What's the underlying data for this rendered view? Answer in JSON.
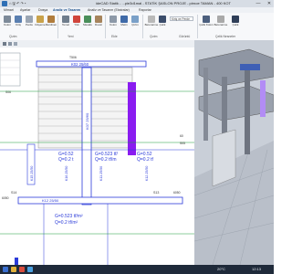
{
  "window": {
    "title": "ideCAD Statik - ...pie3d1mal - STATİK ŞASLON PROJE - pirnoe TAMAN - 400 KOT",
    "quick_access": "⌂ 🖫 ↶ ↷ ▾",
    "minimize": "—",
    "close": "✕"
  },
  "ribbon": {
    "tabs": [
      "Mimari",
      "Ayarlar",
      "Dosya",
      "Analiz ve Tasarım",
      "Analiz ve Tasarım (Ekstralar)",
      "Raporlar"
    ],
    "active_tab": "Analiz ve Tasarım",
    "buttons": [
      "Kolon",
      "Kiriş",
      "Perde",
      "Döşeme",
      "Merdiven",
      "Temel",
      "Yük",
      "Mesafe",
      "Duvar",
      "Kolon",
      "Metin",
      "Çizim",
      "Betonarme",
      "Çelik",
      "Çelik Kolon",
      "Betonarme",
      "Çelik"
    ],
    "groups": [
      "Çizim",
      "Yeni",
      "Ekle",
      "Çizim",
      "Görüntü",
      "Çelik Nesneler"
    ],
    "combo": "Kiriş ve Perde"
  },
  "drawing": {
    "grid_top": "T506",
    "beam_top": "K02 25/60",
    "beam_vertical": "K07 25/60",
    "beam_left_1": "K15 25/50",
    "beam_left_2": "K16 25/50",
    "beam_mid": "K11 25/50",
    "beam_right": "K12 25/50",
    "beam_bottom": "K12 25/50",
    "slab_1": "S14",
    "slab_2": "S13",
    "dim_left": "80",
    "dim_right": "60",
    "load_g1": "G=0.52",
    "load_q1": "Q=0.2 t",
    "load_g2": "G=0.523 tf/",
    "load_q2": "Q=0.2 tf/m",
    "load_g3": "G=0.52",
    "load_q3": "Q=0.2 tf",
    "load_g4": "G=0.523 tf/m²",
    "load_q4": "Q=0.2 tf/m²",
    "side_label_1": "S06",
    "side_label_2": "S05",
    "corner_label": "6050",
    "left_corner": "6050"
  },
  "taskbar": {
    "weather": "20°C",
    "time": "12:13"
  },
  "colors": {
    "accent": "#1a4f8b",
    "beam_blue": "#2b3bd9",
    "column_purple": "#8a1cf0",
    "axis_green": "#1c9a3a",
    "load_magenta": "#ff44ff"
  }
}
